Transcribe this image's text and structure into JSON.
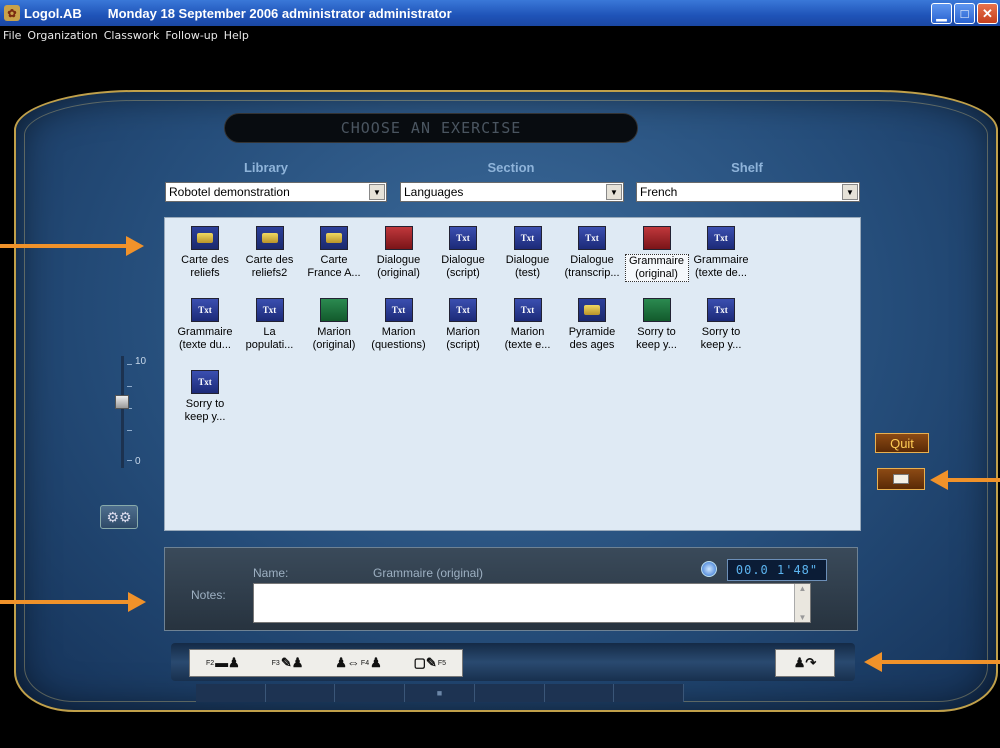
{
  "window": {
    "app_name": "Logol.AB",
    "title_info": "Monday 18 September 2006  administrator administrator",
    "controls": [
      "minimize",
      "maximize",
      "close"
    ]
  },
  "menu": [
    "File",
    "Organization",
    "Classwork",
    "Follow-up",
    "Help"
  ],
  "banner": "CHOOSE AN EXERCISE",
  "columns": {
    "library": {
      "label": "Library",
      "value": "Robotel demonstration"
    },
    "section": {
      "label": "Section",
      "value": "Languages"
    },
    "shelf": {
      "label": "Shelf",
      "value": "French"
    }
  },
  "exercises": [
    {
      "l1": "Carte des",
      "l2": "reliefs",
      "icon": "image"
    },
    {
      "l1": "Carte des",
      "l2": "reliefs2",
      "icon": "image"
    },
    {
      "l1": "Carte",
      "l2": "France A...",
      "icon": "image"
    },
    {
      "l1": "Dialogue",
      "l2": "(original)",
      "icon": "audio"
    },
    {
      "l1": "Dialogue",
      "l2": "(script)",
      "icon": "text"
    },
    {
      "l1": "Dialogue",
      "l2": "(test)",
      "icon": "text"
    },
    {
      "l1": "Dialogue",
      "l2": "(transcrip...",
      "icon": "text"
    },
    {
      "l1": "Grammaire",
      "l2": "(original)",
      "icon": "audio",
      "selected": true
    },
    {
      "l1": "Grammaire",
      "l2": "(texte de...",
      "icon": "text"
    },
    {
      "l1": "Grammaire",
      "l2": "(texte du...",
      "icon": "text"
    },
    {
      "l1": "La",
      "l2": "populati...",
      "icon": "text"
    },
    {
      "l1": "Marion",
      "l2": "(original)",
      "icon": "video"
    },
    {
      "l1": "Marion",
      "l2": "(questions)",
      "icon": "text"
    },
    {
      "l1": "Marion",
      "l2": "(script)",
      "icon": "text"
    },
    {
      "l1": "Marion",
      "l2": "(texte e...",
      "icon": "text"
    },
    {
      "l1": "Pyramide",
      "l2": "des ages",
      "icon": "image"
    },
    {
      "l1": "Sorry to",
      "l2": "keep y...",
      "icon": "video"
    },
    {
      "l1": "Sorry to",
      "l2": "keep y...",
      "icon": "text"
    },
    {
      "l1": "Sorry to",
      "l2": "keep y...",
      "icon": "text"
    }
  ],
  "icon_text": "Txt",
  "slider": {
    "max_label": "10",
    "min_label": "0",
    "level": 0.6
  },
  "quit_label": "Quit",
  "details": {
    "name_label": "Name:",
    "name_value": "Grammaire (original)",
    "notes_label": "Notes:",
    "notes_value": "",
    "timer": "00.0 1'48\""
  },
  "toolbar": {
    "f2": "F2",
    "f3": "F3",
    "f4": "F4",
    "f5": "F5"
  },
  "colors": {
    "accent_orange": "#f0922a",
    "console_blue": "#3d6c9c",
    "gold": "#c0a04a"
  }
}
